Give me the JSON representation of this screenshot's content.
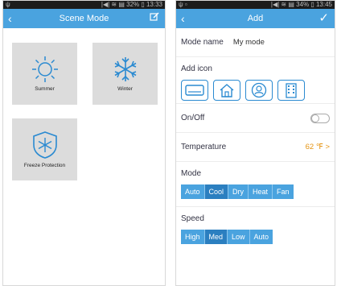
{
  "left": {
    "status": {
      "left": "ψ",
      "right": "|◀| ≋ ▤ 32% ▯ 13:33"
    },
    "title": "Scene Mode",
    "scenes": [
      {
        "label": "Summer"
      },
      {
        "label": "Winter"
      },
      {
        "label": "Freeze Protection"
      }
    ]
  },
  "right": {
    "status": {
      "left": "ψ ▫",
      "right": "|◀| ≋ ▤ 34% ▯ 13:45"
    },
    "title": "Add",
    "mode_name_label": "Mode name",
    "mode_name_value": "My mode",
    "add_icon_label": "Add icon",
    "onoff_label": "On/Off",
    "temperature_label": "Temperature",
    "temperature_value": "62 ℉ >",
    "mode_label": "Mode",
    "modes": [
      "Auto",
      "Cool",
      "Dry",
      "Heat",
      "Fan"
    ],
    "speed_label": "Speed",
    "speeds": [
      "High",
      "Med",
      "Low",
      "Auto"
    ],
    "accent": "#4aa3df",
    "selected_accent": "#2b7fc0",
    "temp_color": "#e59413"
  }
}
